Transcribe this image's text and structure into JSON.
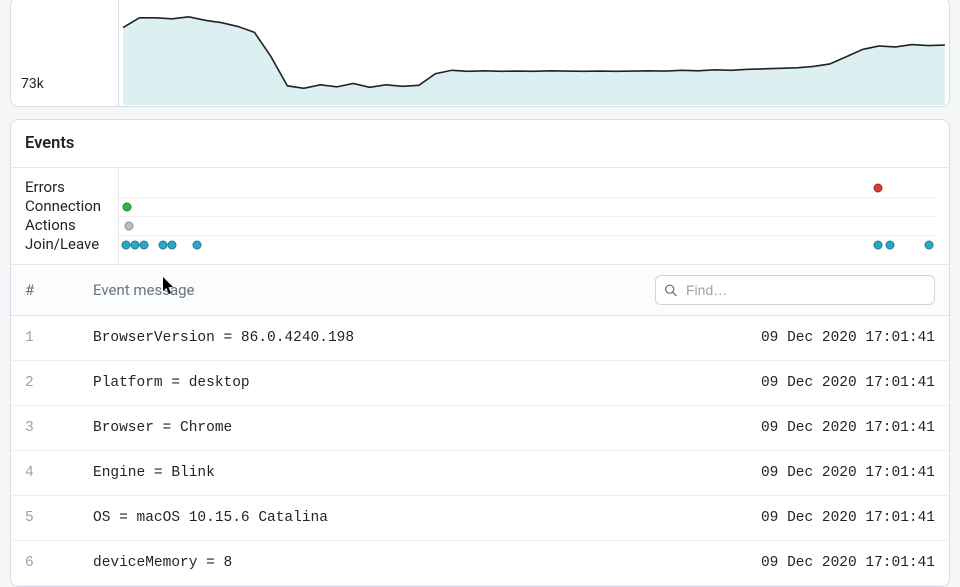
{
  "chart_data": {
    "type": "line",
    "ylabel_tick": "73k",
    "ylim": [
      70000,
      90000
    ],
    "x": [
      0,
      2,
      4,
      6,
      8,
      10,
      12,
      14,
      16,
      18,
      20,
      22,
      24,
      26,
      28,
      30,
      32,
      34,
      36,
      38,
      40,
      42,
      44,
      46,
      48,
      50,
      52,
      54,
      56,
      58,
      60,
      62,
      64,
      66,
      68,
      70,
      72,
      74,
      76,
      78,
      80,
      82,
      84,
      86,
      88,
      90,
      92,
      94,
      96,
      98,
      100
    ],
    "values": [
      86000,
      88000,
      88000,
      87800,
      88200,
      87500,
      87000,
      86200,
      85000,
      80000,
      74000,
      73500,
      74200,
      73800,
      74500,
      73700,
      74200,
      73900,
      74100,
      76500,
      77200,
      77000,
      77100,
      77000,
      77050,
      77000,
      77100,
      77050,
      77000,
      77050,
      77000,
      77050,
      77100,
      77050,
      77200,
      77100,
      77300,
      77200,
      77400,
      77500,
      77600,
      77700,
      78000,
      78500,
      80000,
      81500,
      82200,
      82000,
      82500,
      82300,
      82400
    ],
    "title": "",
    "xlabel": ""
  },
  "events": {
    "heading": "Events",
    "lanes": [
      "Errors",
      "Connection",
      "Actions",
      "Join/Leave"
    ],
    "dots": {
      "Errors": [
        {
          "x": 0.928,
          "color": "#d63b3b"
        }
      ],
      "Connection": [
        {
          "x": 0.01,
          "color": "#2fb34a"
        }
      ],
      "Actions": [
        {
          "x": 0.012,
          "color": "#b8bec4"
        }
      ],
      "Join/Leave": [
        {
          "x": 0.008,
          "color": "#2aa7c9"
        },
        {
          "x": 0.02,
          "color": "#2aa7c9"
        },
        {
          "x": 0.031,
          "color": "#2aa7c9"
        },
        {
          "x": 0.054,
          "color": "#2aa7c9"
        },
        {
          "x": 0.065,
          "color": "#2aa7c9"
        },
        {
          "x": 0.095,
          "color": "#2aa7c9"
        },
        {
          "x": 0.928,
          "color": "#2aa7c9"
        },
        {
          "x": 0.942,
          "color": "#2aa7c9"
        },
        {
          "x": 0.99,
          "color": "#2aa7c9"
        }
      ]
    },
    "table": {
      "col_idx": "#",
      "col_msg": "Event message",
      "find_placeholder": "Find…",
      "rows": [
        {
          "n": "1",
          "msg": "BrowserVersion = 86.0.4240.198",
          "ts": "09 Dec 2020 17:01:41"
        },
        {
          "n": "2",
          "msg": "Platform = desktop",
          "ts": "09 Dec 2020 17:01:41"
        },
        {
          "n": "3",
          "msg": "Browser = Chrome",
          "ts": "09 Dec 2020 17:01:41"
        },
        {
          "n": "4",
          "msg": "Engine = Blink",
          "ts": "09 Dec 2020 17:01:41"
        },
        {
          "n": "5",
          "msg": "OS = macOS 10.15.6 Catalina",
          "ts": "09 Dec 2020 17:01:41"
        },
        {
          "n": "6",
          "msg": "deviceMemory = 8",
          "ts": "09 Dec 2020 17:01:41"
        }
      ]
    }
  }
}
